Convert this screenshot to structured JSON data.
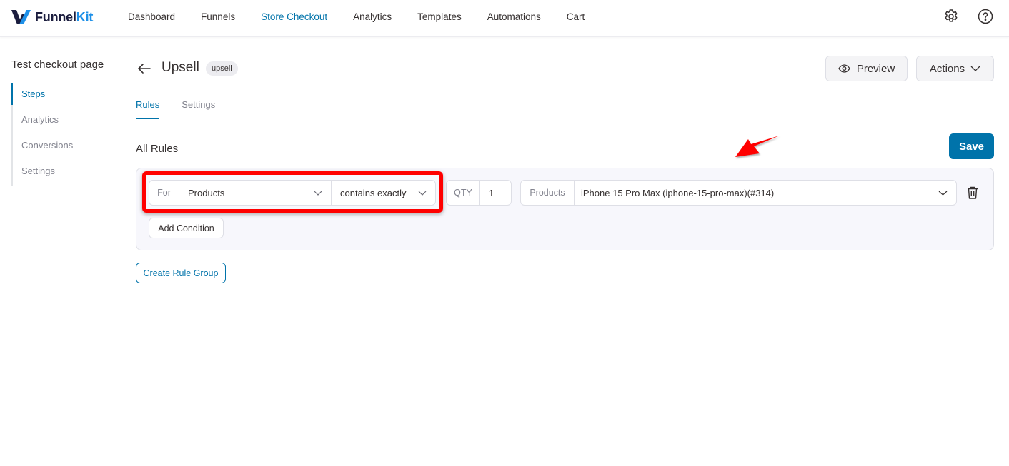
{
  "brand": {
    "name_part1": "Funnel",
    "name_part2": "Kit",
    "accent": "#0073aa",
    "logo_dark": "#1b1d3e",
    "logo_light": "#1e90e8"
  },
  "nav": {
    "items": [
      {
        "label": "Dashboard",
        "active": false
      },
      {
        "label": "Funnels",
        "active": false
      },
      {
        "label": "Store Checkout",
        "active": true
      },
      {
        "label": "Analytics",
        "active": false
      },
      {
        "label": "Templates",
        "active": false
      },
      {
        "label": "Automations",
        "active": false
      },
      {
        "label": "Cart",
        "active": false
      }
    ],
    "icons": [
      "gear-icon",
      "help-icon"
    ]
  },
  "sidebar": {
    "title": "Test checkout page",
    "items": [
      {
        "label": "Steps",
        "active": true
      },
      {
        "label": "Analytics",
        "active": false
      },
      {
        "label": "Conversions",
        "active": false
      },
      {
        "label": "Settings",
        "active": false
      }
    ]
  },
  "header": {
    "title": "Upsell",
    "badge": "upsell",
    "preview_label": "Preview",
    "actions_label": "Actions"
  },
  "tabs": [
    {
      "label": "Rules",
      "active": true
    },
    {
      "label": "Settings",
      "active": false
    }
  ],
  "rules": {
    "section_title": "All Rules",
    "save_label": "Save",
    "condition": {
      "for_label": "For",
      "rule_type": "Products",
      "operator": "contains exactly",
      "qty_label": "QTY",
      "qty_value": "1",
      "products_label": "Products",
      "products_value": "iPhone 15 Pro Max (iphone-15-pro-max)(#314)"
    },
    "add_condition_label": "Add Condition",
    "create_group_label": "Create Rule Group"
  },
  "annotations": {
    "highlight_color": "#ff0000",
    "arrow_color": "#ff0000"
  }
}
